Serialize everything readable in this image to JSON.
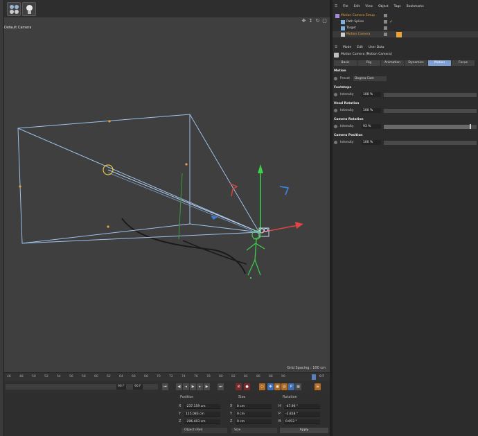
{
  "viewport": {
    "camera_label": "Default Camera",
    "grid_spacing": "Grid Spacing : 100 cm"
  },
  "timeline": {
    "ticks": [
      "46",
      "48",
      "50",
      "52",
      "54",
      "56",
      "58",
      "60",
      "62",
      "64",
      "66",
      "68",
      "70",
      "72",
      "74",
      "76",
      "78",
      "80",
      "82",
      "84",
      "86",
      "88",
      "90"
    ],
    "current_frame": "0 F",
    "start_field": "90 F",
    "end_field": "90 F"
  },
  "object_manager": {
    "menu": [
      "File",
      "Edit",
      "View",
      "Object",
      "Tags",
      "Bookmarks"
    ],
    "objects": [
      {
        "name": "Motion Camera Setup",
        "color": "#e8a33a"
      },
      {
        "name": "Path Spline",
        "color": "#d8d8d8"
      },
      {
        "name": "Target",
        "color": "#d8d8d8"
      },
      {
        "name": "Motion Camera",
        "color": "#e8a33a"
      }
    ]
  },
  "attributes": {
    "menu": [
      "Mode",
      "Edit",
      "User Data"
    ],
    "title": "Motion Camera [Motion Camera]",
    "tabs": [
      "Basic",
      "Rig",
      "Animation",
      "Dynamics",
      "Motion",
      "Focus"
    ],
    "active_tab": "Motion",
    "motion": {
      "heading": "Motion",
      "preset_label": "Preset",
      "preset_value": "Dogma Cam"
    },
    "sections": [
      {
        "title": "Footsteps",
        "label": "Intensity",
        "value": "100 %",
        "level": 0
      },
      {
        "title": "Head Rotation",
        "label": "Intensity",
        "value": "100 %",
        "level": 0
      },
      {
        "title": "Camera Rotation",
        "label": "Intensity",
        "value": "93 %",
        "level": 0.93
      },
      {
        "title": "Camera Position",
        "label": "Intensity",
        "value": "100 %",
        "level": 0
      }
    ]
  },
  "coordinates": {
    "headers": [
      "Position",
      "Size",
      "Rotation"
    ],
    "position": [
      {
        "axis": "X",
        "value": "-237.159 cm"
      },
      {
        "axis": "Y",
        "value": "115.083 cm"
      },
      {
        "axis": "Z",
        "value": "-296.403 cm"
      }
    ],
    "size": [
      {
        "axis": "X",
        "value": "0 cm"
      },
      {
        "axis": "Y",
        "value": "0 cm"
      },
      {
        "axis": "Z",
        "value": "0 cm"
      }
    ],
    "rotation": [
      {
        "axis": "H",
        "value": "-47.96 °"
      },
      {
        "axis": "P",
        "value": "-2.818 °"
      },
      {
        "axis": "B",
        "value": "0.053 °"
      }
    ],
    "mode_select": "Object (Rel)",
    "size_select": "Size",
    "apply_label": "Apply"
  },
  "colors": {
    "accent_blue": "#7f9ed3",
    "selection_orange": "#e8a33a",
    "camera_frustum": "#9fc2ea"
  }
}
